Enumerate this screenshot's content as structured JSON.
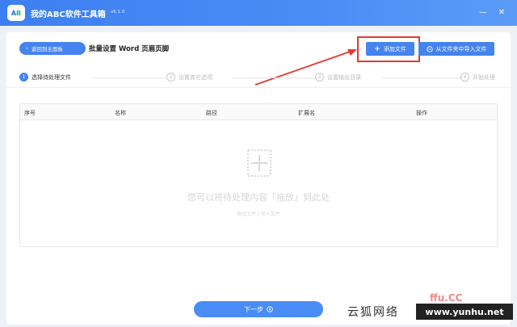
{
  "window": {
    "title": "我的ABC软件工具箱",
    "version": "v6.1.0",
    "logo_text_a": "A",
    "logo_text_b": "B",
    "min_icon": "—",
    "close_icon": "✕"
  },
  "header": {
    "back_label": "返回到主面板",
    "page_title": "批量设置 Word 页眉页脚",
    "add_file_label": "添加文件",
    "import_label": "从文件夹中导入文件"
  },
  "steps": [
    {
      "num": "1",
      "label": "选择待处理文件"
    },
    {
      "num": "2",
      "label": "设置其它选项"
    },
    {
      "num": "3",
      "label": "设置输出目录"
    },
    {
      "num": "4",
      "label": "开始处理"
    }
  ],
  "table": {
    "columns": [
      "序号",
      "名称",
      "路径",
      "扩展名",
      "操作"
    ],
    "empty_text": "您可以将待处理内容「拖放」到此处",
    "empty_sub": "拖动文件 | 导入文件"
  },
  "footer": {
    "next_label": "下一步"
  },
  "watermark": {
    "text": "云狐网络",
    "url": "www.yunhu.net",
    "red_text": "ffu.CC"
  },
  "colors": {
    "primary": "#4583ee",
    "highlight": "#e23a2e"
  }
}
